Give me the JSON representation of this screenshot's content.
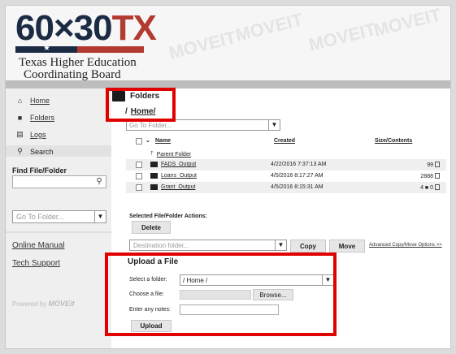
{
  "header": {
    "logo_number": "60×30",
    "logo_state": "TX",
    "logo_line1": "Texas Higher Education",
    "logo_line2": "Coordinating Board",
    "watermark": "MOVEIT"
  },
  "sidebar": {
    "nav": [
      {
        "label": "Home",
        "icon": "home-icon"
      },
      {
        "label": "Folders",
        "icon": "folder-icon"
      },
      {
        "label": "Logs",
        "icon": "calendar-icon"
      },
      {
        "label": "Search",
        "icon": "search-icon"
      }
    ],
    "find_label": "Find File/Folder",
    "goto_placeholder": "Go To Folder...",
    "online_manual": "Online Manual",
    "tech_support": "Tech Support",
    "powered_by": "Powered by",
    "powered_brand": "MOVEit"
  },
  "main": {
    "folders_title": "Folders",
    "breadcrumb_sep": "/",
    "breadcrumb_home": "Home/",
    "goto_placeholder": "Go To Folder...",
    "columns": {
      "name": "Name",
      "created": "Created",
      "size": "Size/Contents"
    },
    "parent_folder": "Parent Folder",
    "rows": [
      {
        "name": "FADS_Output",
        "created": "4/22/2016 7:37:13 AM",
        "size": "99"
      },
      {
        "name": "Loans_Output",
        "created": "4/5/2016 8:17:27 AM",
        "size": "2888"
      },
      {
        "name": "Grant_Output",
        "created": "4/5/2016 8:15:31 AM",
        "size": "4 ■ 0"
      }
    ],
    "actions_label": "Selected File/Folder Actions:",
    "delete_label": "Delete",
    "dest_placeholder": "Destination folder...",
    "copy_label": "Copy",
    "move_label": "Move",
    "advanced_link": "Advanced Copy/Move Options >>"
  },
  "upload": {
    "title": "Upload a File",
    "select_folder_label": "Select a folder:",
    "folder_value": "/ Home /",
    "choose_file_label": "Choose a file:",
    "browse_label": "Browse...",
    "notes_label": "Enter any notes:",
    "upload_label": "Upload"
  },
  "colors": {
    "highlight": "#e00000",
    "brand_navy": "#1c2b44",
    "brand_red": "#b23a30"
  }
}
